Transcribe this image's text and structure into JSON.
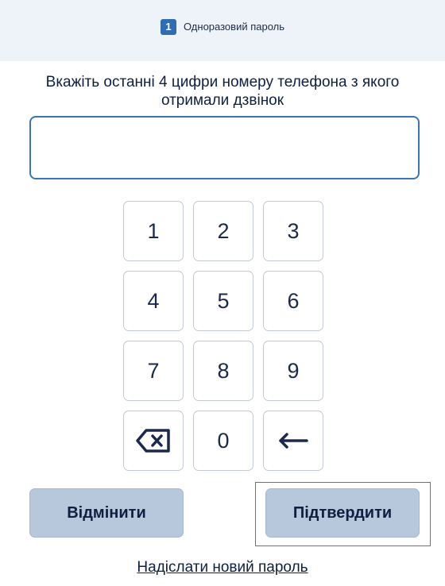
{
  "header": {
    "step_number": "1",
    "step_title": "Одноразовий пароль",
    "background": "#eef3f9",
    "badge_color": "#2f6db3"
  },
  "instruction": "Вкажіть останні 4 цифри номеру телефона з якого отримали дзвінок",
  "code_input": {
    "value": "",
    "placeholder": "",
    "border_color": "#3b73b8"
  },
  "keypad": {
    "keys": [
      "1",
      "2",
      "3",
      "4",
      "5",
      "6",
      "7",
      "8",
      "9"
    ],
    "zero": "0",
    "clear_icon": "backspace-x-icon",
    "back_icon": "arrow-left-icon"
  },
  "buttons": {
    "cancel_label": "Відмінити",
    "confirm_label": "Підтвердити",
    "color": "#b7c8dc",
    "highlight_color": "#e0413e"
  },
  "resend_link": "Надіслати новий пароль"
}
